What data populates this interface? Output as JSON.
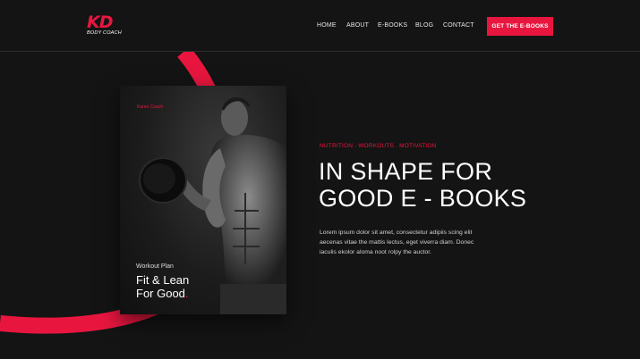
{
  "logo": {
    "mark": "KD",
    "subtitle": "BODY COACH"
  },
  "nav": {
    "items": [
      "HOME",
      "ABOUT",
      "E-BOOKS",
      "BLOG",
      "CONTACT"
    ]
  },
  "cta": {
    "label": "GET THE E-BOOKS"
  },
  "book": {
    "author": "Karen Coach",
    "plan": "Workout Plan",
    "title_lines": [
      "Fit & Lean",
      "For Good"
    ],
    "title_dot": "."
  },
  "hero": {
    "tags": "NUTRITION . WORKOUTS . MOTIVATION",
    "headline_lines": [
      "IN SHAPE FOR",
      "GOOD E - BOOKS"
    ],
    "body_lines": [
      "Lorem ipsum dolor sit amet, consectetur adipiis scing elit",
      "aecenas vitae the mattis lectus, eget viverra diam. Donec",
      "iaculis ekolor aloma noot rolpy the auctor."
    ]
  },
  "colors": {
    "accent": "#e8163f",
    "background": "#141414"
  },
  "icons": {
    "book_figure": "bodybuilder-dumbbell-image"
  }
}
